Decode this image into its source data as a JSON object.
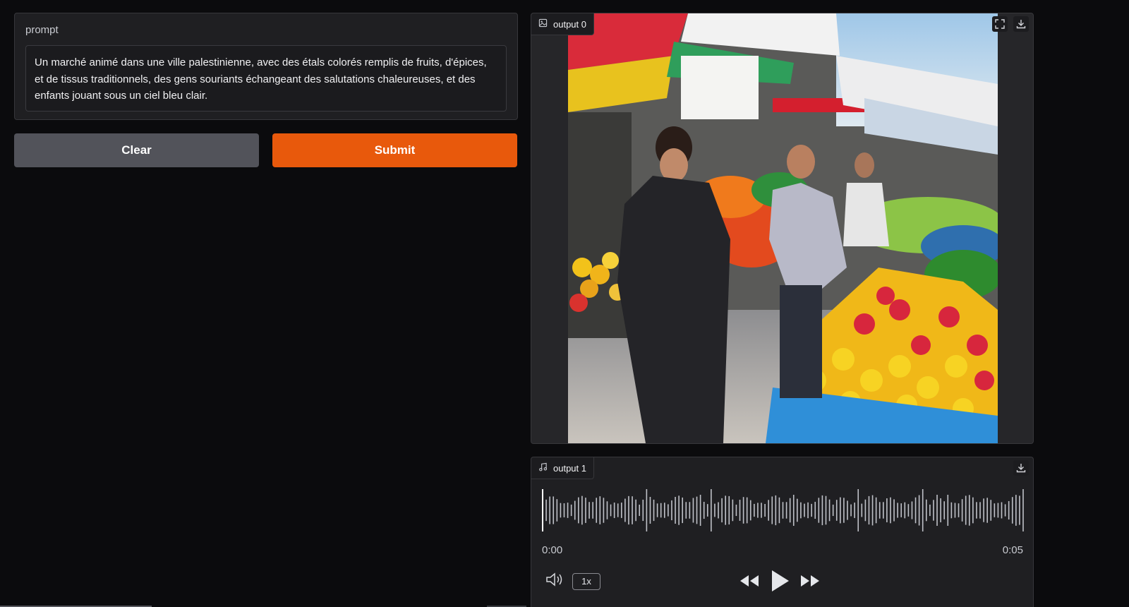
{
  "prompt": {
    "label": "prompt",
    "value": "Un marché animé dans une ville palestinienne, avec des étals colorés remplis de fruits, d'épices, et de tissus traditionnels, des gens souriants échangeant des salutations chaleureuses, et des enfants jouant sous un ciel bleu clair."
  },
  "buttons": {
    "clear": "Clear",
    "submit": "Submit"
  },
  "image_output": {
    "label": "output 0",
    "icons": [
      "image-icon",
      "fullscreen-icon",
      "download-icon"
    ]
  },
  "audio_output": {
    "label": "output 1",
    "time_start": "0:00",
    "time_end": "0:05",
    "speed": "1x",
    "icons": [
      "music-icon",
      "download-icon",
      "volume-icon",
      "rewind-icon",
      "play-icon",
      "fast-forward-icon"
    ]
  },
  "colors": {
    "accent": "#e8590c",
    "secondary_button": "#52535a",
    "background": "#0b0b0d",
    "panel": "#1f1f22"
  }
}
